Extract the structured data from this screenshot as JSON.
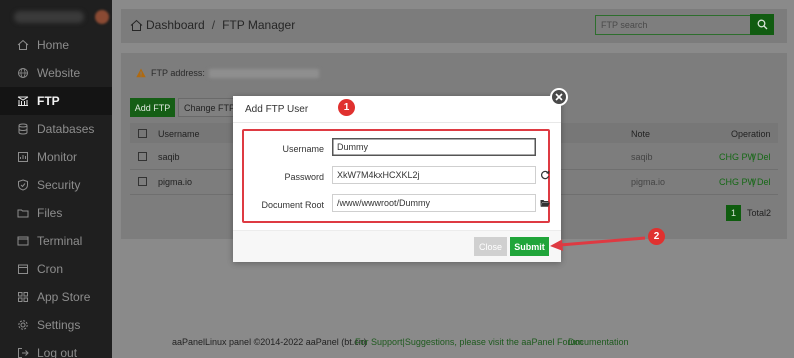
{
  "sidebar": {
    "items": [
      {
        "label": "Home",
        "icon": "home-icon"
      },
      {
        "label": "Website",
        "icon": "globe-icon"
      },
      {
        "label": "FTP",
        "icon": "ftp-icon",
        "active": true
      },
      {
        "label": "Databases",
        "icon": "database-icon"
      },
      {
        "label": "Monitor",
        "icon": "monitor-icon"
      },
      {
        "label": "Security",
        "icon": "shield-icon"
      },
      {
        "label": "Files",
        "icon": "folder-icon"
      },
      {
        "label": "Terminal",
        "icon": "terminal-icon"
      },
      {
        "label": "Cron",
        "icon": "calendar-icon"
      },
      {
        "label": "App Store",
        "icon": "grid-icon"
      },
      {
        "label": "Settings",
        "icon": "gear-icon"
      },
      {
        "label": "Log out",
        "icon": "logout-icon"
      }
    ]
  },
  "breadcrumb": {
    "home": "Dashboard",
    "separator": "/",
    "current": "FTP Manager"
  },
  "search": {
    "placeholder": "FTP search"
  },
  "panel": {
    "ftp_address_label": "FTP address:",
    "add_button": "Add FTP",
    "change_button": "Change FTP p",
    "table": {
      "headers": {
        "username": "Username",
        "note": "Note",
        "operation": "Operation"
      },
      "rows": [
        {
          "username": "saqib",
          "note": "saqib",
          "op1": "CHG PW",
          "sep": "|",
          "op2": "Del"
        },
        {
          "username": "pigma.io",
          "note": "pigma.io",
          "op1": "CHG PW",
          "sep": "|",
          "op2": "Del"
        }
      ]
    },
    "pagination": {
      "page": "1",
      "total": "Total2"
    }
  },
  "footer": {
    "copyright": "aaPanelLinux panel ©2014-2022 aaPanel (bt.cn)",
    "support_link": "For Support|Suggestions, please visit the aaPanel Forum",
    "docs_link": "Documentation"
  },
  "modal": {
    "title": "Add FTP User",
    "fields": {
      "username_label": "Username",
      "username_value": "Dummy",
      "password_label": "Password",
      "password_value": "XkW7M4kxHCXKL2j",
      "docroot_label": "Document Root",
      "docroot_value": "/www/wwwroot/Dummy"
    },
    "close_button": "Close",
    "submit_button": "Submit"
  },
  "annotations": {
    "badge1": "1",
    "badge2": "2",
    "highlight_color": "#de3a42"
  },
  "colors": {
    "accent_green": "#20a53a",
    "sidebar_bg": "#1f1f1f"
  }
}
